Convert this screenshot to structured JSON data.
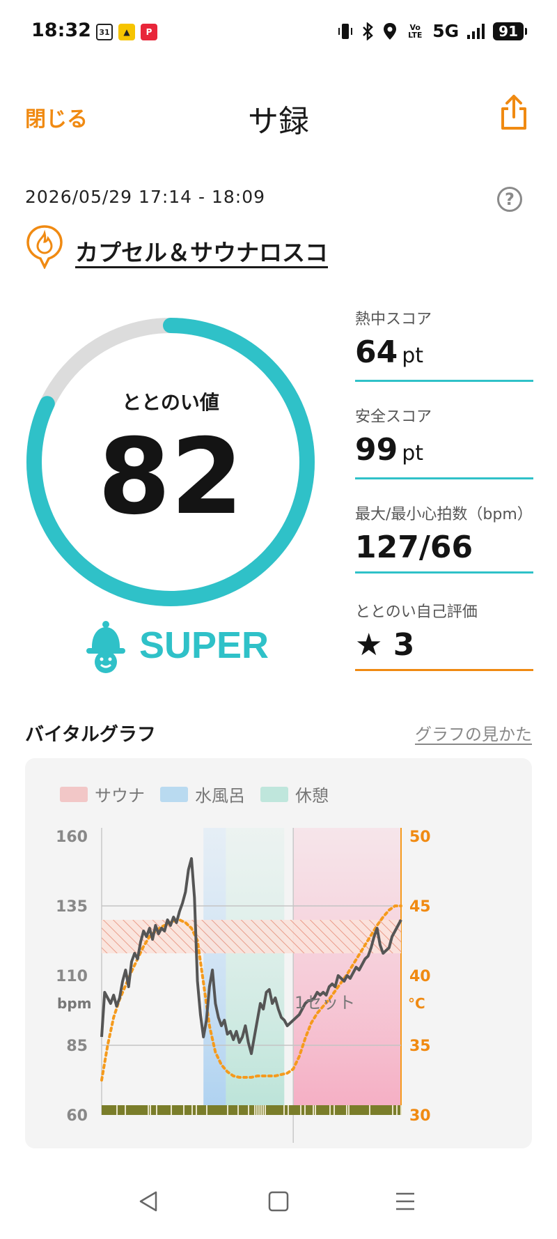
{
  "status_bar": {
    "time": "18:32",
    "apps": [
      "31",
      "▲",
      "P"
    ],
    "network": "5G",
    "volte": "Vo LTE",
    "battery": "91"
  },
  "header": {
    "close_label": "閉じる",
    "title": "サ録",
    "share_icon": "share-icon"
  },
  "session": {
    "datetime": "2026/05/29 17:14 - 18:09",
    "help": "?",
    "facility": "カプセル＆サウナロスコ"
  },
  "score": {
    "label": "ととのい値",
    "value": "82",
    "fraction": 0.82,
    "rank": "SUPER",
    "accent_color": "#2fc1c8"
  },
  "stats": [
    {
      "label": "熱中スコア",
      "value": "64",
      "unit": "pt"
    },
    {
      "label": "安全スコア",
      "value": "99",
      "unit": "pt"
    },
    {
      "label": "最大/最小心拍数（bpm）",
      "value": "127/66",
      "unit": ""
    },
    {
      "label": "ととのい自己評価",
      "value": "★ 3",
      "unit": ""
    }
  ],
  "vital": {
    "title": "バイタルグラフ",
    "link": "グラフの見かた",
    "legend": [
      {
        "label": "サウナ",
        "color": "#f2c7c7"
      },
      {
        "label": "水風呂",
        "color": "#b9daf0"
      },
      {
        "label": "休憩",
        "color": "#bfe6dc"
      }
    ],
    "set_label": "1セット",
    "y_left_unit": "bpm",
    "y_right_unit": "°C"
  },
  "chart_data": {
    "type": "line",
    "y_left_ticks": [
      "160",
      "135",
      "110",
      "85",
      "60"
    ],
    "y_right_ticks": [
      "50",
      "45",
      "40",
      "35",
      "30"
    ],
    "y_left_range": [
      60,
      160
    ],
    "y_right_range": [
      30,
      50
    ],
    "x_range": [
      0,
      100
    ],
    "phases": [
      {
        "type": "water",
        "start": 34,
        "end": 41.5
      },
      {
        "type": "rest",
        "start": 41.5,
        "end": 61
      },
      {
        "type": "sauna",
        "start": 64,
        "end": 100
      }
    ],
    "hr_zone": [
      118,
      130
    ],
    "heart_rate": {
      "name": "",
      "x": [
        0,
        1,
        2,
        3,
        4,
        5,
        6,
        7,
        8,
        9,
        10,
        11,
        12,
        13,
        14,
        15,
        16,
        17,
        18,
        19,
        20,
        21,
        22,
        23,
        24,
        25,
        26,
        27,
        28,
        29,
        30,
        31,
        32,
        33,
        34,
        35,
        36,
        37,
        38,
        39,
        40,
        41,
        42,
        43,
        44,
        45,
        46,
        47,
        48,
        49,
        50,
        51,
        52,
        53,
        54,
        55,
        56,
        57,
        58,
        59,
        60,
        61,
        62,
        63,
        64,
        65,
        66,
        67,
        68,
        69,
        70,
        71,
        72,
        73,
        74,
        75,
        76,
        77,
        78,
        79,
        80,
        81,
        82,
        83,
        84,
        85,
        86,
        87,
        88,
        89,
        90,
        91,
        92,
        93,
        94,
        95,
        96,
        97,
        98,
        99,
        100
      ],
      "values": [
        88,
        104,
        102,
        100,
        103,
        99,
        102,
        108,
        112,
        106,
        115,
        118,
        116,
        122,
        126,
        124,
        127,
        123,
        128,
        125,
        127,
        126,
        130,
        128,
        131,
        129,
        133,
        136,
        140,
        148,
        152,
        138,
        108,
        96,
        88,
        94,
        106,
        112,
        100,
        95,
        92,
        94,
        89,
        90,
        87,
        90,
        86,
        88,
        92,
        86,
        82,
        88,
        94,
        100,
        98,
        104,
        105,
        100,
        102,
        98,
        95,
        94,
        92,
        93,
        94,
        95,
        96,
        98,
        100,
        101,
        101,
        102,
        104,
        103,
        104,
        103,
        106,
        107,
        106,
        110,
        109,
        108,
        110,
        109,
        111,
        113,
        112,
        114,
        116,
        117,
        120,
        124,
        127,
        121,
        118,
        119,
        120,
        124,
        126,
        128,
        130
      ]
    },
    "body_temp": {
      "name": "",
      "x": [
        0,
        2,
        4,
        6,
        8,
        10,
        12,
        14,
        16,
        18,
        20,
        22,
        24,
        26,
        28,
        30,
        32,
        34,
        36,
        38,
        40,
        42,
        44,
        46,
        48,
        50,
        52,
        54,
        56,
        58,
        60,
        62,
        64,
        66,
        68,
        70,
        72,
        74,
        76,
        78,
        80,
        82,
        84,
        86,
        88,
        90,
        92,
        94,
        96,
        98,
        100
      ],
      "values": [
        32.5,
        35,
        37,
        38.3,
        39.3,
        40.3,
        41.2,
        42.1,
        42.8,
        43.2,
        43.5,
        43.7,
        43.9,
        44,
        43.8,
        43.4,
        42.5,
        39.5,
        36.4,
        34.5,
        33.6,
        33.1,
        32.8,
        32.7,
        32.7,
        32.7,
        32.8,
        32.8,
        32.8,
        32.8,
        32.9,
        33,
        33.3,
        34.2,
        35.5,
        36.6,
        37.3,
        37.8,
        38.3,
        38.9,
        39.5,
        40.1,
        40.8,
        41.5,
        42.2,
        42.9,
        43.6,
        44.2,
        44.7,
        45,
        45
      ]
    }
  }
}
